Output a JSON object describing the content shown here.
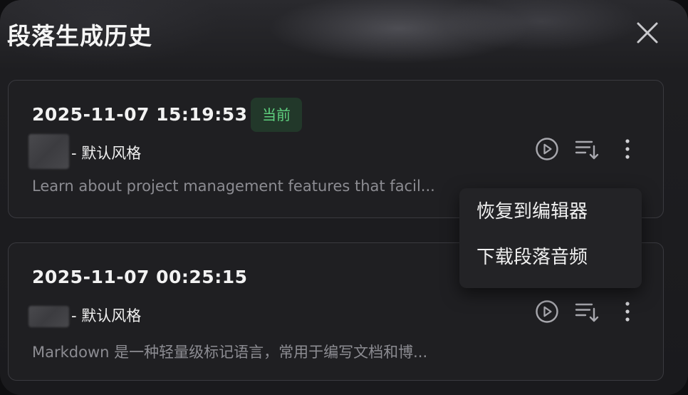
{
  "dialog": {
    "title": "段落生成历史"
  },
  "history": [
    {
      "timestamp": "2025-11-07 15:19:53",
      "badge": "当前",
      "style": "- 默认风格",
      "preview": "Learn about project management features that facil..."
    },
    {
      "timestamp": "2025-11-07 00:25:15",
      "style": "- 默认风格",
      "preview": "Markdown 是一种轻量级标记语言，常用于编写文档和博..."
    }
  ],
  "context_menu": {
    "items": [
      "恢复到编辑器",
      "下载段落音频"
    ]
  },
  "colors": {
    "badge_text": "#5fd17f",
    "badge_bg": "#22382a",
    "card_bg": "#1f1f22"
  },
  "icons": {
    "close": "close-icon",
    "play": "play-circle-icon",
    "queue": "playlist-sort-icon",
    "more": "more-vertical-icon"
  }
}
